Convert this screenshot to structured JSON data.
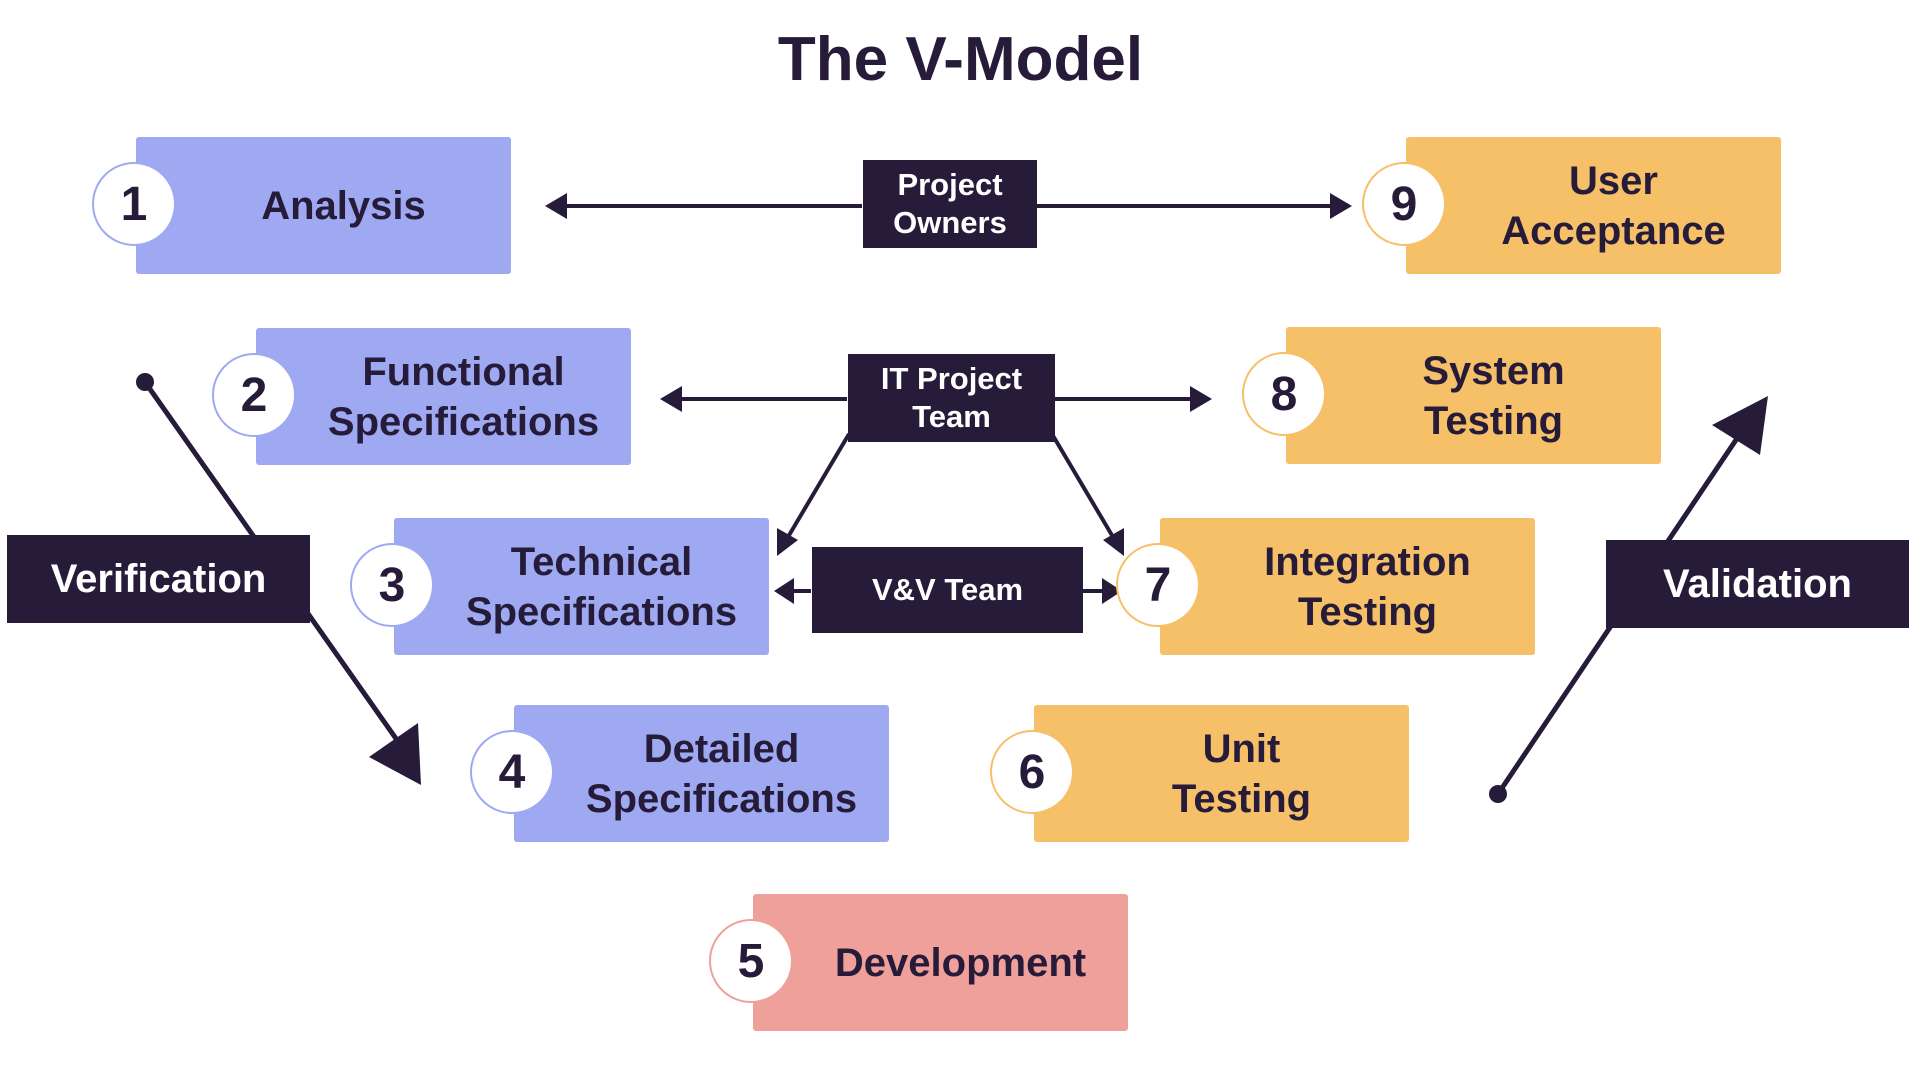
{
  "title": "The V-Model",
  "colors": {
    "specification": "#9ea9f2",
    "testing": "#f6c069",
    "development": "#f0a09b",
    "dark": "#271b3a"
  },
  "stages": [
    {
      "number": "1",
      "label": "Analysis",
      "phase": "specification"
    },
    {
      "number": "2",
      "label": "Functional\nSpecifications",
      "phase": "specification"
    },
    {
      "number": "3",
      "label": "Technical\nSpecifications",
      "phase": "specification"
    },
    {
      "number": "4",
      "label": "Detailed\nSpecifications",
      "phase": "specification"
    },
    {
      "number": "5",
      "label": "Development",
      "phase": "development"
    },
    {
      "number": "6",
      "label": "Unit\nTesting",
      "phase": "testing"
    },
    {
      "number": "7",
      "label": "Integration\nTesting",
      "phase": "testing"
    },
    {
      "number": "8",
      "label": "System\nTesting",
      "phase": "testing"
    },
    {
      "number": "9",
      "label": "User\nAcceptance",
      "phase": "testing"
    }
  ],
  "teams": {
    "project_owners": "Project\nOwners",
    "it_project_team": "IT Project\nTeam",
    "vv_team": "V&V Team"
  },
  "side_labels": {
    "verification": "Verification",
    "validation": "Validation"
  }
}
